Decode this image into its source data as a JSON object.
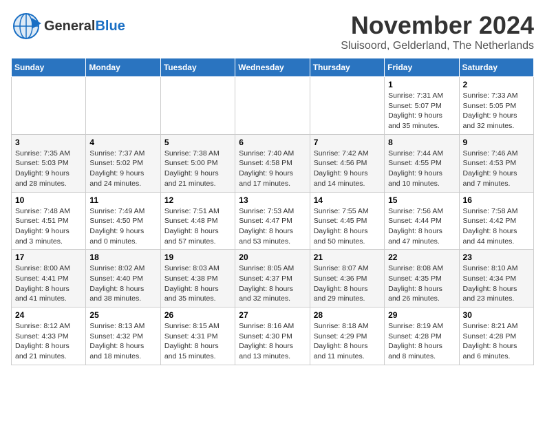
{
  "header": {
    "logo_general": "General",
    "logo_blue": "Blue",
    "month_title": "November 2024",
    "subtitle": "Sluisoord, Gelderland, The Netherlands"
  },
  "weekdays": [
    "Sunday",
    "Monday",
    "Tuesday",
    "Wednesday",
    "Thursday",
    "Friday",
    "Saturday"
  ],
  "weeks": [
    [
      {
        "day": "",
        "info": ""
      },
      {
        "day": "",
        "info": ""
      },
      {
        "day": "",
        "info": ""
      },
      {
        "day": "",
        "info": ""
      },
      {
        "day": "",
        "info": ""
      },
      {
        "day": "1",
        "info": "Sunrise: 7:31 AM\nSunset: 5:07 PM\nDaylight: 9 hours and 35 minutes."
      },
      {
        "day": "2",
        "info": "Sunrise: 7:33 AM\nSunset: 5:05 PM\nDaylight: 9 hours and 32 minutes."
      }
    ],
    [
      {
        "day": "3",
        "info": "Sunrise: 7:35 AM\nSunset: 5:03 PM\nDaylight: 9 hours and 28 minutes."
      },
      {
        "day": "4",
        "info": "Sunrise: 7:37 AM\nSunset: 5:02 PM\nDaylight: 9 hours and 24 minutes."
      },
      {
        "day": "5",
        "info": "Sunrise: 7:38 AM\nSunset: 5:00 PM\nDaylight: 9 hours and 21 minutes."
      },
      {
        "day": "6",
        "info": "Sunrise: 7:40 AM\nSunset: 4:58 PM\nDaylight: 9 hours and 17 minutes."
      },
      {
        "day": "7",
        "info": "Sunrise: 7:42 AM\nSunset: 4:56 PM\nDaylight: 9 hours and 14 minutes."
      },
      {
        "day": "8",
        "info": "Sunrise: 7:44 AM\nSunset: 4:55 PM\nDaylight: 9 hours and 10 minutes."
      },
      {
        "day": "9",
        "info": "Sunrise: 7:46 AM\nSunset: 4:53 PM\nDaylight: 9 hours and 7 minutes."
      }
    ],
    [
      {
        "day": "10",
        "info": "Sunrise: 7:48 AM\nSunset: 4:51 PM\nDaylight: 9 hours and 3 minutes."
      },
      {
        "day": "11",
        "info": "Sunrise: 7:49 AM\nSunset: 4:50 PM\nDaylight: 9 hours and 0 minutes."
      },
      {
        "day": "12",
        "info": "Sunrise: 7:51 AM\nSunset: 4:48 PM\nDaylight: 8 hours and 57 minutes."
      },
      {
        "day": "13",
        "info": "Sunrise: 7:53 AM\nSunset: 4:47 PM\nDaylight: 8 hours and 53 minutes."
      },
      {
        "day": "14",
        "info": "Sunrise: 7:55 AM\nSunset: 4:45 PM\nDaylight: 8 hours and 50 minutes."
      },
      {
        "day": "15",
        "info": "Sunrise: 7:56 AM\nSunset: 4:44 PM\nDaylight: 8 hours and 47 minutes."
      },
      {
        "day": "16",
        "info": "Sunrise: 7:58 AM\nSunset: 4:42 PM\nDaylight: 8 hours and 44 minutes."
      }
    ],
    [
      {
        "day": "17",
        "info": "Sunrise: 8:00 AM\nSunset: 4:41 PM\nDaylight: 8 hours and 41 minutes."
      },
      {
        "day": "18",
        "info": "Sunrise: 8:02 AM\nSunset: 4:40 PM\nDaylight: 8 hours and 38 minutes."
      },
      {
        "day": "19",
        "info": "Sunrise: 8:03 AM\nSunset: 4:38 PM\nDaylight: 8 hours and 35 minutes."
      },
      {
        "day": "20",
        "info": "Sunrise: 8:05 AM\nSunset: 4:37 PM\nDaylight: 8 hours and 32 minutes."
      },
      {
        "day": "21",
        "info": "Sunrise: 8:07 AM\nSunset: 4:36 PM\nDaylight: 8 hours and 29 minutes."
      },
      {
        "day": "22",
        "info": "Sunrise: 8:08 AM\nSunset: 4:35 PM\nDaylight: 8 hours and 26 minutes."
      },
      {
        "day": "23",
        "info": "Sunrise: 8:10 AM\nSunset: 4:34 PM\nDaylight: 8 hours and 23 minutes."
      }
    ],
    [
      {
        "day": "24",
        "info": "Sunrise: 8:12 AM\nSunset: 4:33 PM\nDaylight: 8 hours and 21 minutes."
      },
      {
        "day": "25",
        "info": "Sunrise: 8:13 AM\nSunset: 4:32 PM\nDaylight: 8 hours and 18 minutes."
      },
      {
        "day": "26",
        "info": "Sunrise: 8:15 AM\nSunset: 4:31 PM\nDaylight: 8 hours and 15 minutes."
      },
      {
        "day": "27",
        "info": "Sunrise: 8:16 AM\nSunset: 4:30 PM\nDaylight: 8 hours and 13 minutes."
      },
      {
        "day": "28",
        "info": "Sunrise: 8:18 AM\nSunset: 4:29 PM\nDaylight: 8 hours and 11 minutes."
      },
      {
        "day": "29",
        "info": "Sunrise: 8:19 AM\nSunset: 4:28 PM\nDaylight: 8 hours and 8 minutes."
      },
      {
        "day": "30",
        "info": "Sunrise: 8:21 AM\nSunset: 4:28 PM\nDaylight: 8 hours and 6 minutes."
      }
    ]
  ]
}
